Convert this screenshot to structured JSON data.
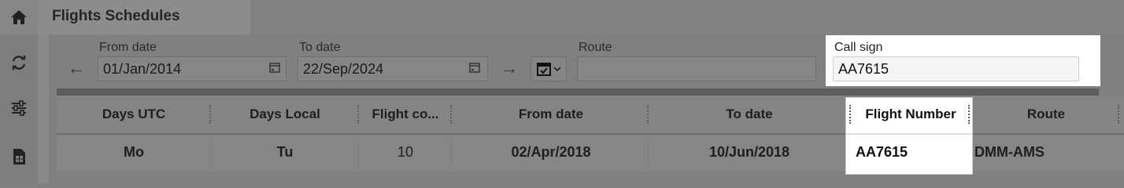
{
  "header": {
    "title": "Flights Schedules"
  },
  "sidebar": {
    "icons": [
      "home-icon",
      "refresh-icon",
      "sliders-icon",
      "document-icon"
    ]
  },
  "filters": {
    "from_date": {
      "label": "From date",
      "value": "01/Jan/2014"
    },
    "to_date": {
      "label": "To date",
      "value": "22/Sep/2024"
    },
    "route": {
      "label": "Route",
      "value": ""
    },
    "call_sign": {
      "label": "Call sign",
      "value": "AA7615"
    }
  },
  "grid": {
    "columns": [
      "Days UTC",
      "Days Local",
      "Flight co...",
      "From date",
      "To date",
      "Flight Number",
      "Route"
    ],
    "rows": [
      [
        "Mo",
        "Tu",
        "10",
        "02/Apr/2018",
        "10/Jun/2018",
        "AA7615",
        "DMM-AMS"
      ]
    ]
  },
  "colors": {
    "highlight": "#ffffff",
    "overlay": "#808080"
  }
}
